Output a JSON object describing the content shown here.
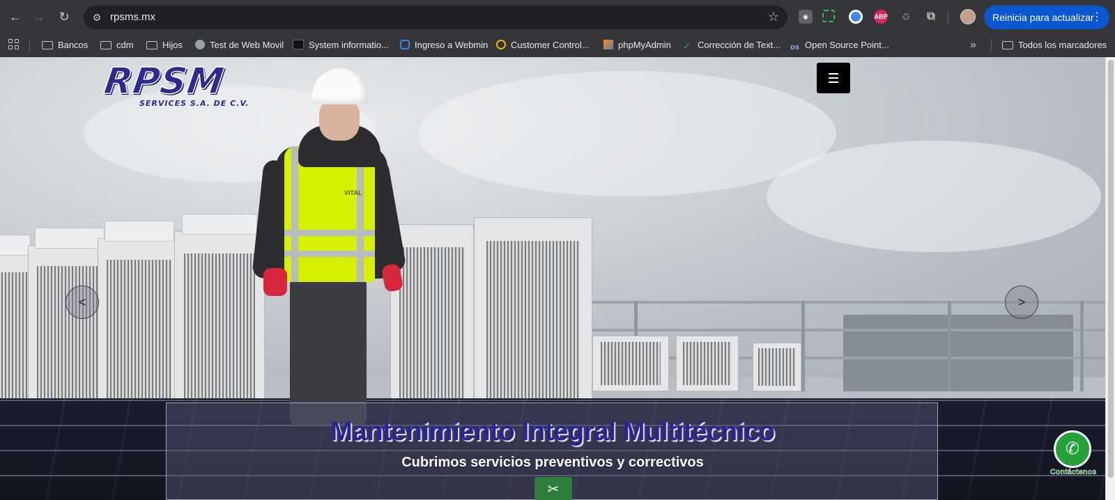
{
  "browser": {
    "url": "rpsms.mx",
    "update_button": "Reinicia para actualizar",
    "bookmarks": [
      {
        "label": "Bancos"
      },
      {
        "label": "cdm"
      },
      {
        "label": "Hijos"
      },
      {
        "label": "Test de Web Movil"
      },
      {
        "label": "System informatio..."
      },
      {
        "label": "Ingreso a Webmin"
      },
      {
        "label": "Customer Control..."
      },
      {
        "label": "phpMyAdmin"
      },
      {
        "label": "Corrección de Text..."
      },
      {
        "label": "Open Source Point..."
      }
    ],
    "more_bookmarks": "»",
    "all_bookmarks": "Todos los marcadores",
    "ext_abp": "ABP"
  },
  "site": {
    "logo_main": "RPSM",
    "logo_sub": "SERVICES S.A. DE C.V.",
    "slider": {
      "prev": "<",
      "next": ">",
      "title": "Mantenimiento Integral Multitécnico",
      "subtitle": "Cubrimos servicios preventivos y correctivos",
      "vest_text": "VITAL"
    },
    "whatsapp_label": "Contáctenos"
  },
  "colors": {
    "brand": "#2e2a8f",
    "whatsapp": "#25a33b",
    "update": "#0b57d0"
  }
}
